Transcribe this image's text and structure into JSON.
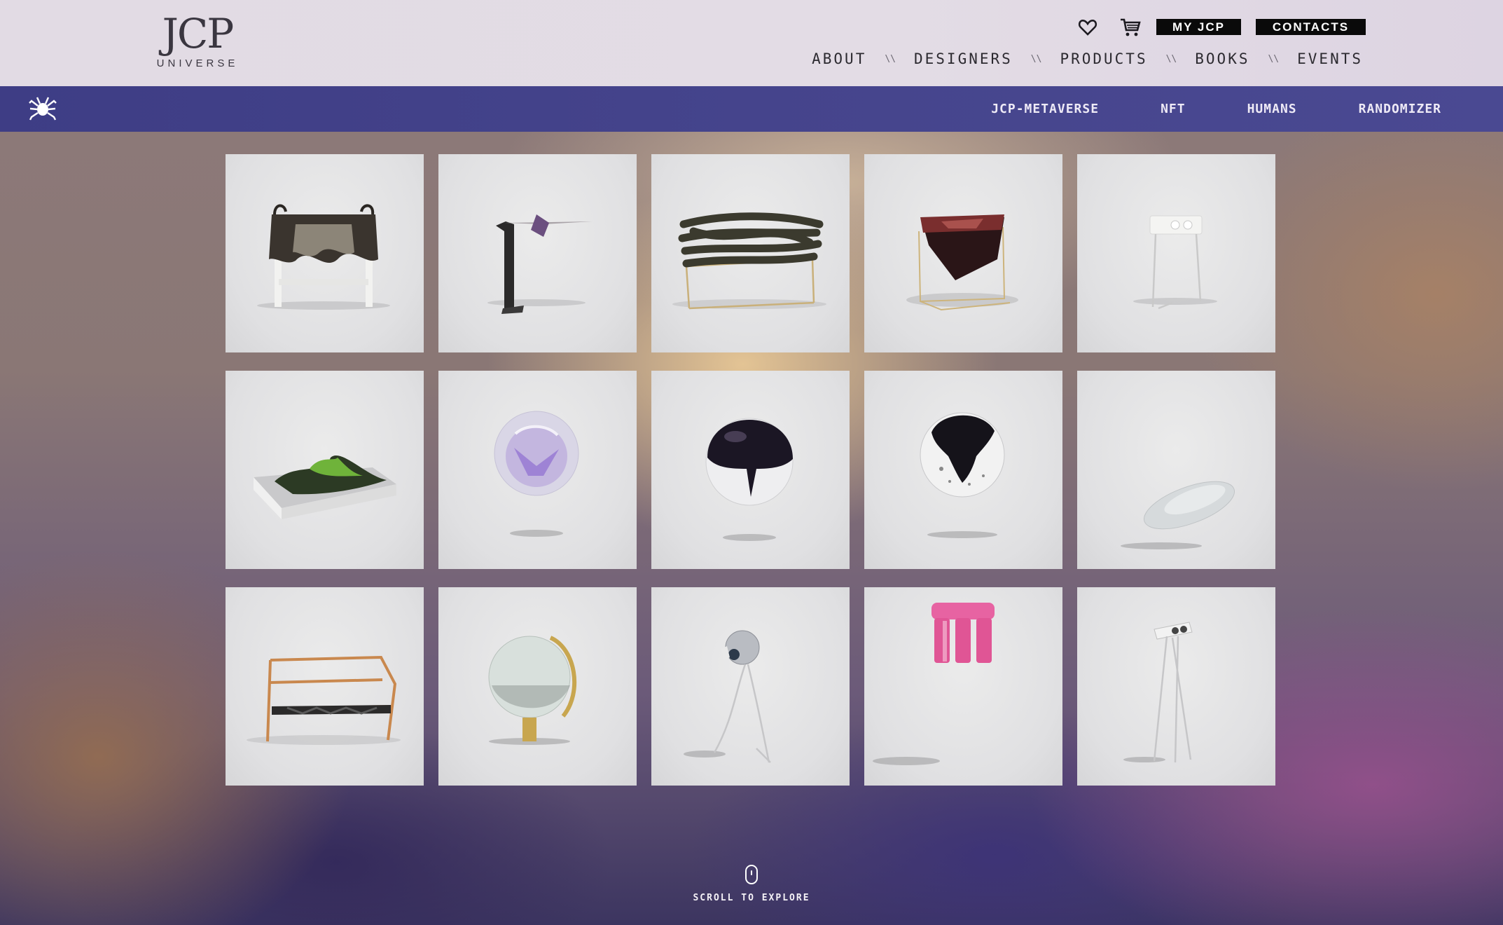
{
  "brand": {
    "logo_mark": "JCP",
    "logo_sub": "UNIVERSE"
  },
  "header": {
    "wishlist_icon": "heart-icon",
    "cart_icon": "cart-icon",
    "my_jcp_label": "MY JCP",
    "contacts_label": "CONTACTS",
    "nav": [
      "ABOUT",
      "DESIGNERS",
      "PRODUCTS",
      "BOOKS",
      "EVENTS"
    ],
    "nav_separator": "\\\\"
  },
  "subnav": {
    "icon": "spider-icon",
    "links": [
      "JCP-METAVERSE",
      "NFT",
      "HUMANS",
      "RANDOMIZER"
    ]
  },
  "grid": {
    "tiles": [
      "draped-stool",
      "cantilever-side-table",
      "tangled-cord-bench",
      "crystal-cube-table",
      "twin-light-lamp",
      "green-moss-tray",
      "violet-glass-sphere",
      "dark-liquid-sphere",
      "black-splash-sphere",
      "floating-disc",
      "copper-frame-sofa",
      "round-mirror-stand",
      "bird-floor-lamp",
      "pink-pillar-stool",
      "tripod-twin-light"
    ]
  },
  "scroll": {
    "icon": "mouse-icon",
    "label": "SCROLL TO EXPLORE"
  },
  "colors": {
    "subnav_bg": "#45448c",
    "header_bg": "#e2dbe4",
    "pill_bg": "#0a0a0a"
  }
}
